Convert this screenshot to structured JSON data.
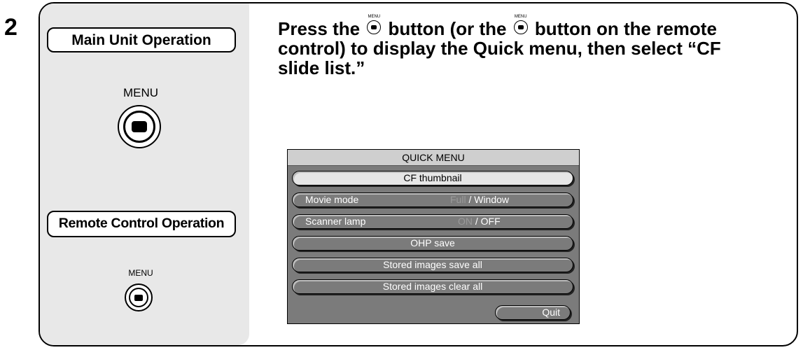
{
  "step_number": "2",
  "main_unit": {
    "heading": "Main Unit Operation",
    "button_caption": "MENU",
    "button_icon": "menu-button-icon"
  },
  "remote": {
    "heading": "Remote Control Operation",
    "button_caption": "MENU",
    "button_icon": "menu-button-icon"
  },
  "instruction": {
    "part1": "Press the ",
    "part2": " button (or the ",
    "part3": " button on the remote control) to display the Quick menu, then select “CF slide list.”",
    "inline_button_caption": "MENU"
  },
  "quick_menu": {
    "title": "QUICK MENU",
    "items": [
      {
        "label": "CF thumbnail",
        "selected": true
      },
      {
        "label": "Movie mode",
        "option_a": "Full",
        "separator": "/",
        "option_b": "Window"
      },
      {
        "label": "Scanner lamp",
        "option_a": "ON",
        "separator": "/",
        "option_b": "OFF"
      },
      {
        "label": "OHP save"
      },
      {
        "label": "Stored images save all"
      },
      {
        "label": "Stored images clear all"
      }
    ],
    "quit_label": "Quit"
  },
  "colors": {
    "panel_bg": "#e8e8e8",
    "menu_bg": "#7b7b7b",
    "menu_selected_bg": "#e6e6e6"
  }
}
